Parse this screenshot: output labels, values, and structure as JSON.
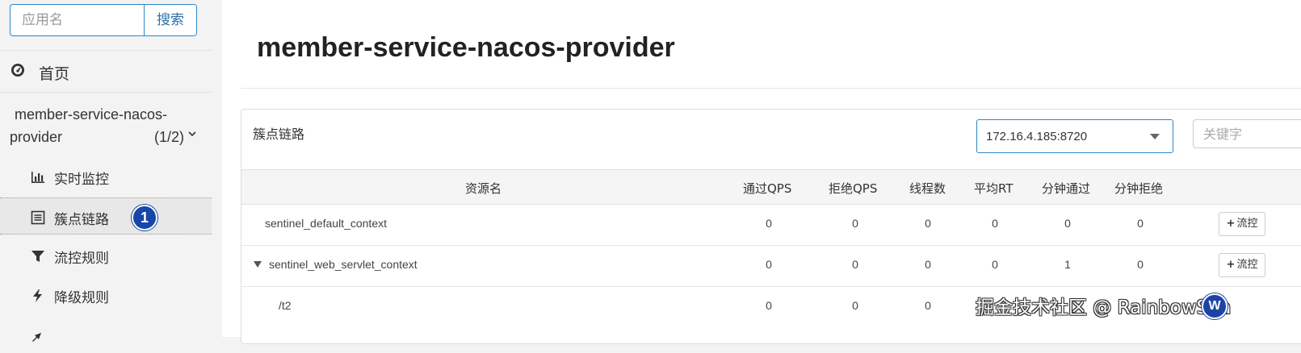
{
  "sidebar": {
    "search": {
      "placeholder": "应用名",
      "button_label": "搜索"
    },
    "home": {
      "icon": "dashboard-icon",
      "label": "首页"
    },
    "app": {
      "name_line1": "member-service-nacos-",
      "name_line2": "provider",
      "count": "(1/2)",
      "icon": "chevron-down-icon"
    },
    "items": [
      {
        "label": "实时监控",
        "icon": "bar-chart-icon"
      },
      {
        "label": "簇点链路",
        "icon": "list-icon",
        "active": true,
        "badge": "1"
      },
      {
        "label": "流控规则",
        "icon": "filter-icon"
      },
      {
        "label": "降级规则",
        "icon": "bolt-icon"
      }
    ]
  },
  "main": {
    "title": "member-service-nacos-provider",
    "panel": {
      "title": "簇点链路",
      "machine_select": "172.16.4.185:8720",
      "keyword_placeholder": "关键字",
      "columns": [
        "资源名",
        "通过QPS",
        "拒绝QPS",
        "线程数",
        "平均RT",
        "分钟通过",
        "分钟拒绝"
      ],
      "rows": [
        {
          "name": "sentinel_default_context",
          "values": [
            "0",
            "0",
            "0",
            "0",
            "0",
            "0"
          ],
          "action": "流控",
          "expandable": false
        },
        {
          "name": "sentinel_web_servlet_context",
          "values": [
            "0",
            "0",
            "0",
            "0",
            "1",
            "0"
          ],
          "action": "流控",
          "expandable": true
        },
        {
          "name": "/t2",
          "values": [
            "0",
            "0",
            "0"
          ]
        }
      ]
    }
  },
  "overlay": {
    "watermark": "掘金技术社区 @ RainbowSea",
    "cursor_badge": "W"
  },
  "colors": {
    "accent": "#2f86c6",
    "badge": "#1646a8"
  }
}
